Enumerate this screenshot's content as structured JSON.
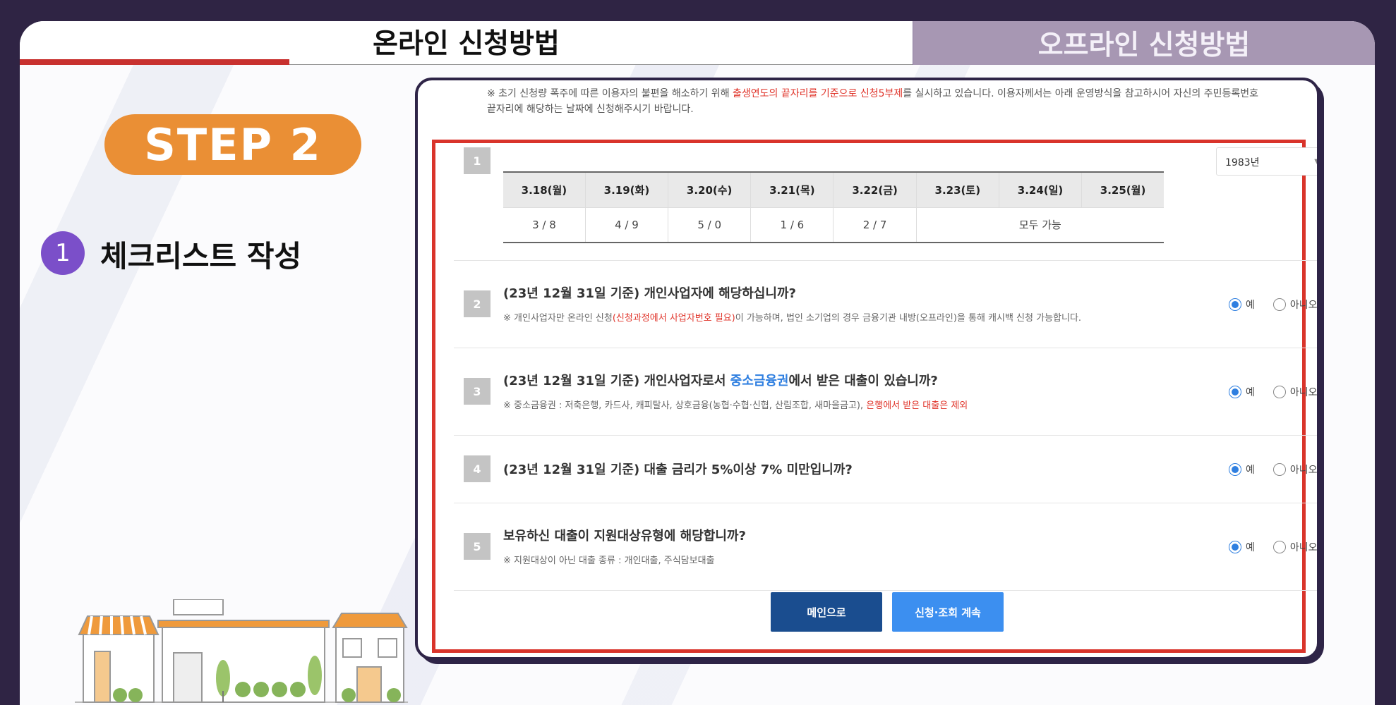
{
  "tabs": {
    "online": "온라인 신청방법",
    "offline": "오프라인 신청방법"
  },
  "step": {
    "label": "STEP 2"
  },
  "checklist": {
    "number": "1",
    "title": "체크리스트 작성"
  },
  "notice": {
    "prefix": "※ 초기 신청량 폭주에 따른 이용자의 불편을 해소하기 위해 ",
    "highlight": "출생연도의 끝자리를 기준으로 신청5부제",
    "suffix": "를 실시하고 있습니다. 이용자께서는 아래 운영방식을 참고하시어 자신의 주민등록번호 끝자리에 해당하는 날짜에 신청해주시기 바랍니다."
  },
  "year_select": {
    "value": "1983년"
  },
  "schedule": {
    "headers": [
      "3.18(월)",
      "3.19(화)",
      "3.20(수)",
      "3.21(목)",
      "3.22(금)",
      "3.23(토)",
      "3.24(일)",
      "3.25(월)"
    ],
    "cells": [
      "3 / 8",
      "4 / 9",
      "5 / 0",
      "1 / 6",
      "2 / 7"
    ],
    "weekend": "모두 가능"
  },
  "questions": [
    {
      "num": "1"
    },
    {
      "num": "2",
      "title": "(23년 12월 31일 기준) 개인사업자에 해당하십니까?",
      "note_prefix": "※ 개인사업자만 온라인 신청",
      "note_highlight": "(신청과정에서 사업자번호 필요)",
      "note_suffix": "이 가능하며, 법인 소기업의 경우 금융기관 내방(오프라인)을 통해 캐시백 신청 가능합니다."
    },
    {
      "num": "3",
      "title_prefix": "(23년 12월 31일 기준) 개인사업자로서 ",
      "title_highlight": "중소금융권",
      "title_suffix": "에서 받은 대출이 있습니까?",
      "note_prefix": "※ 중소금융권 : 저축은행, 카드사, 캐피탈사, 상호금융(농협·수협·신협, 산림조합, 새마을금고), ",
      "note_highlight": "은행에서 받은 대출은 제외"
    },
    {
      "num": "4",
      "title": "(23년 12월 31일 기준) 대출 금리가 5%이상 7% 미만입니까?"
    },
    {
      "num": "5",
      "title": "보유하신 대출이 지원대상유형에 해당합니까?",
      "note": "※ 지원대상이 아닌 대출 종류 : 개인대출, 주식담보대출"
    }
  ],
  "radio": {
    "yes": "예",
    "no": "아니오"
  },
  "buttons": {
    "main": "메인으로",
    "continue": "신청·조회 계속"
  },
  "colors": {
    "accent_orange": "#ea8f35",
    "highlight_red": "#d9342b",
    "primary_blue": "#1a4d8f",
    "secondary_blue": "#3c8ff0",
    "frame_dark": "#2f2444"
  }
}
